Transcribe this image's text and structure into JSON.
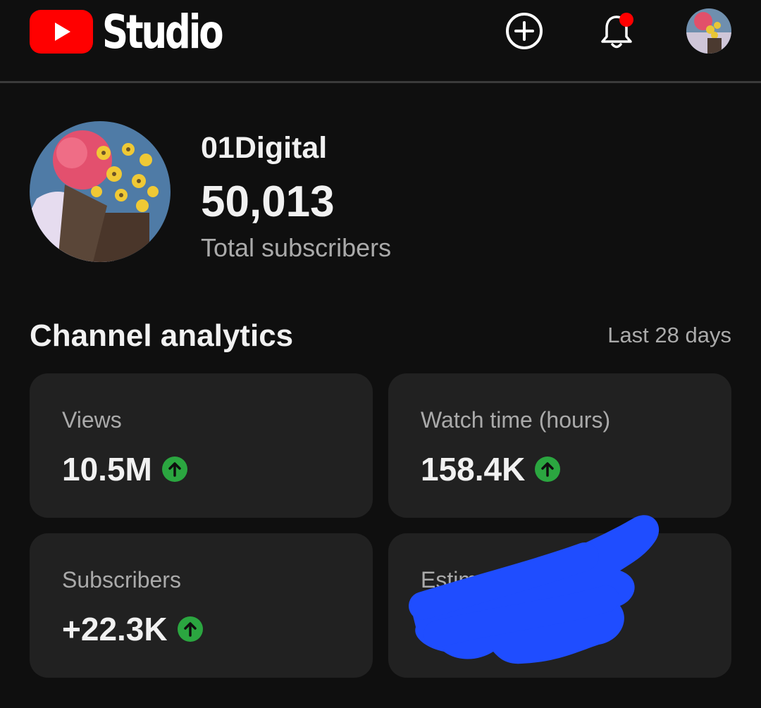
{
  "header": {
    "app_title": "Studio",
    "icons": {
      "logo": "youtube-play-logo",
      "create": "add-circle-icon",
      "notifications": "bell-icon",
      "account": "account-avatar"
    },
    "notification_dot_color": "#ff0000"
  },
  "channel": {
    "name": "01Digital",
    "subscriber_count": "50,013",
    "subscriber_label": "Total subscribers"
  },
  "analytics": {
    "title": "Channel analytics",
    "period": "Last 28 days",
    "cards": [
      {
        "label": "Views",
        "value": "10.5M",
        "trend": "up"
      },
      {
        "label": "Watch time (hours)",
        "value": "158.4K",
        "trend": "up"
      },
      {
        "label": "Subscribers",
        "value": "+22.3K",
        "trend": "up"
      },
      {
        "label": "Estimated re",
        "value": "",
        "trend": ""
      }
    ],
    "trend_up_color": "#2ba640"
  },
  "colors": {
    "background": "#0f0f0f",
    "card": "#212121",
    "brand_red": "#ff0000",
    "redaction_blue": "#1f4dff"
  }
}
